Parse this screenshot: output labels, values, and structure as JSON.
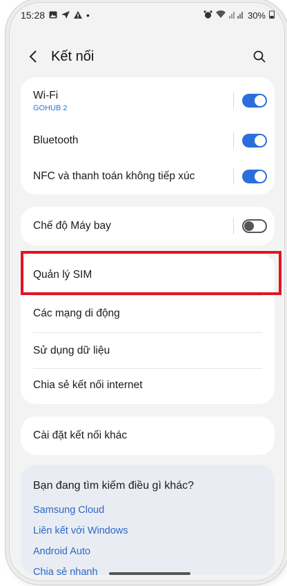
{
  "status": {
    "time": "15:28",
    "notif_icons": [
      "image-icon",
      "send-icon",
      "alert-icon"
    ],
    "dot": "•",
    "battery": "30%"
  },
  "header": {
    "title": "Kết nối"
  },
  "groups": {
    "wireless": [
      {
        "label": "Wi-Fi",
        "sub": "GOHUB 2",
        "toggle": "on"
      },
      {
        "label": "Bluetooth",
        "toggle": "on"
      },
      {
        "label": "NFC và thanh toán không tiếp xúc",
        "toggle": "on"
      }
    ],
    "airplane": {
      "label": "Chế độ Máy bay",
      "toggle": "off"
    },
    "sim_group": [
      {
        "label": "Quản lý SIM"
      },
      {
        "label": "Các mạng di động"
      },
      {
        "label": "Sử dụng dữ liệu"
      },
      {
        "label": "Chia sẻ kết nối internet"
      }
    ],
    "more": {
      "label": "Cài đặt kết nối khác"
    }
  },
  "suggest": {
    "title": "Bạn đang tìm kiếm điều gì khác?",
    "links": [
      "Samsung Cloud",
      "Liên kết với Windows",
      "Android Auto",
      "Chia sẻ nhanh"
    ]
  },
  "colors": {
    "accent": "#2a6fdb",
    "highlight": "#e0141e",
    "link": "#2c67c5"
  }
}
